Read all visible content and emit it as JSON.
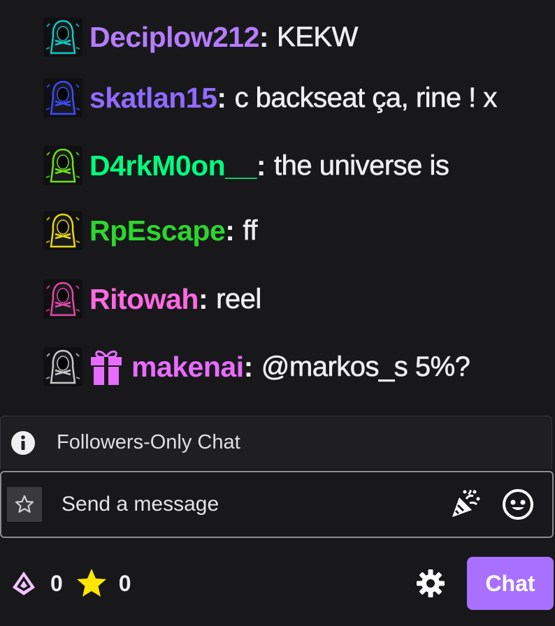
{
  "messages": [
    {
      "username": "Deciplow212",
      "text": "KEKW",
      "user_color": "#b67cff",
      "badge_color": "#14c8c0",
      "gift": false
    },
    {
      "username": "skatlan15",
      "text": "c backseat ça, rine ! x",
      "user_color": "#8f6bff",
      "badge_color": "#3c4cff",
      "gift": false
    },
    {
      "username": "D4rkM0on__",
      "text": "the universe is",
      "user_color": "#00ff7f",
      "badge_color": "#6ee01a",
      "gift": false
    },
    {
      "username": "RpEscape",
      "text": "ff",
      "user_color": "#2ed52e",
      "badge_color": "#e6d813",
      "gift": false
    },
    {
      "username": "Ritowah",
      "text": "reel",
      "user_color": "#ff69e1",
      "badge_color": "#e04aa6",
      "gift": false
    },
    {
      "username": "makenai",
      "text": "@markos_s 5%?",
      "user_color": "#e86cff",
      "badge_color": "#c8c8c8",
      "gift": true
    }
  ],
  "notice": {
    "icon": "info-icon",
    "text": "Followers-Only Chat"
  },
  "input": {
    "placeholder": "Send a message"
  },
  "bottom": {
    "bits_count": "0",
    "points_count": "0",
    "chat_button": "Chat"
  },
  "colors": {
    "accent": "#a970ff",
    "background": "#18181b",
    "star": "#ffe600"
  }
}
